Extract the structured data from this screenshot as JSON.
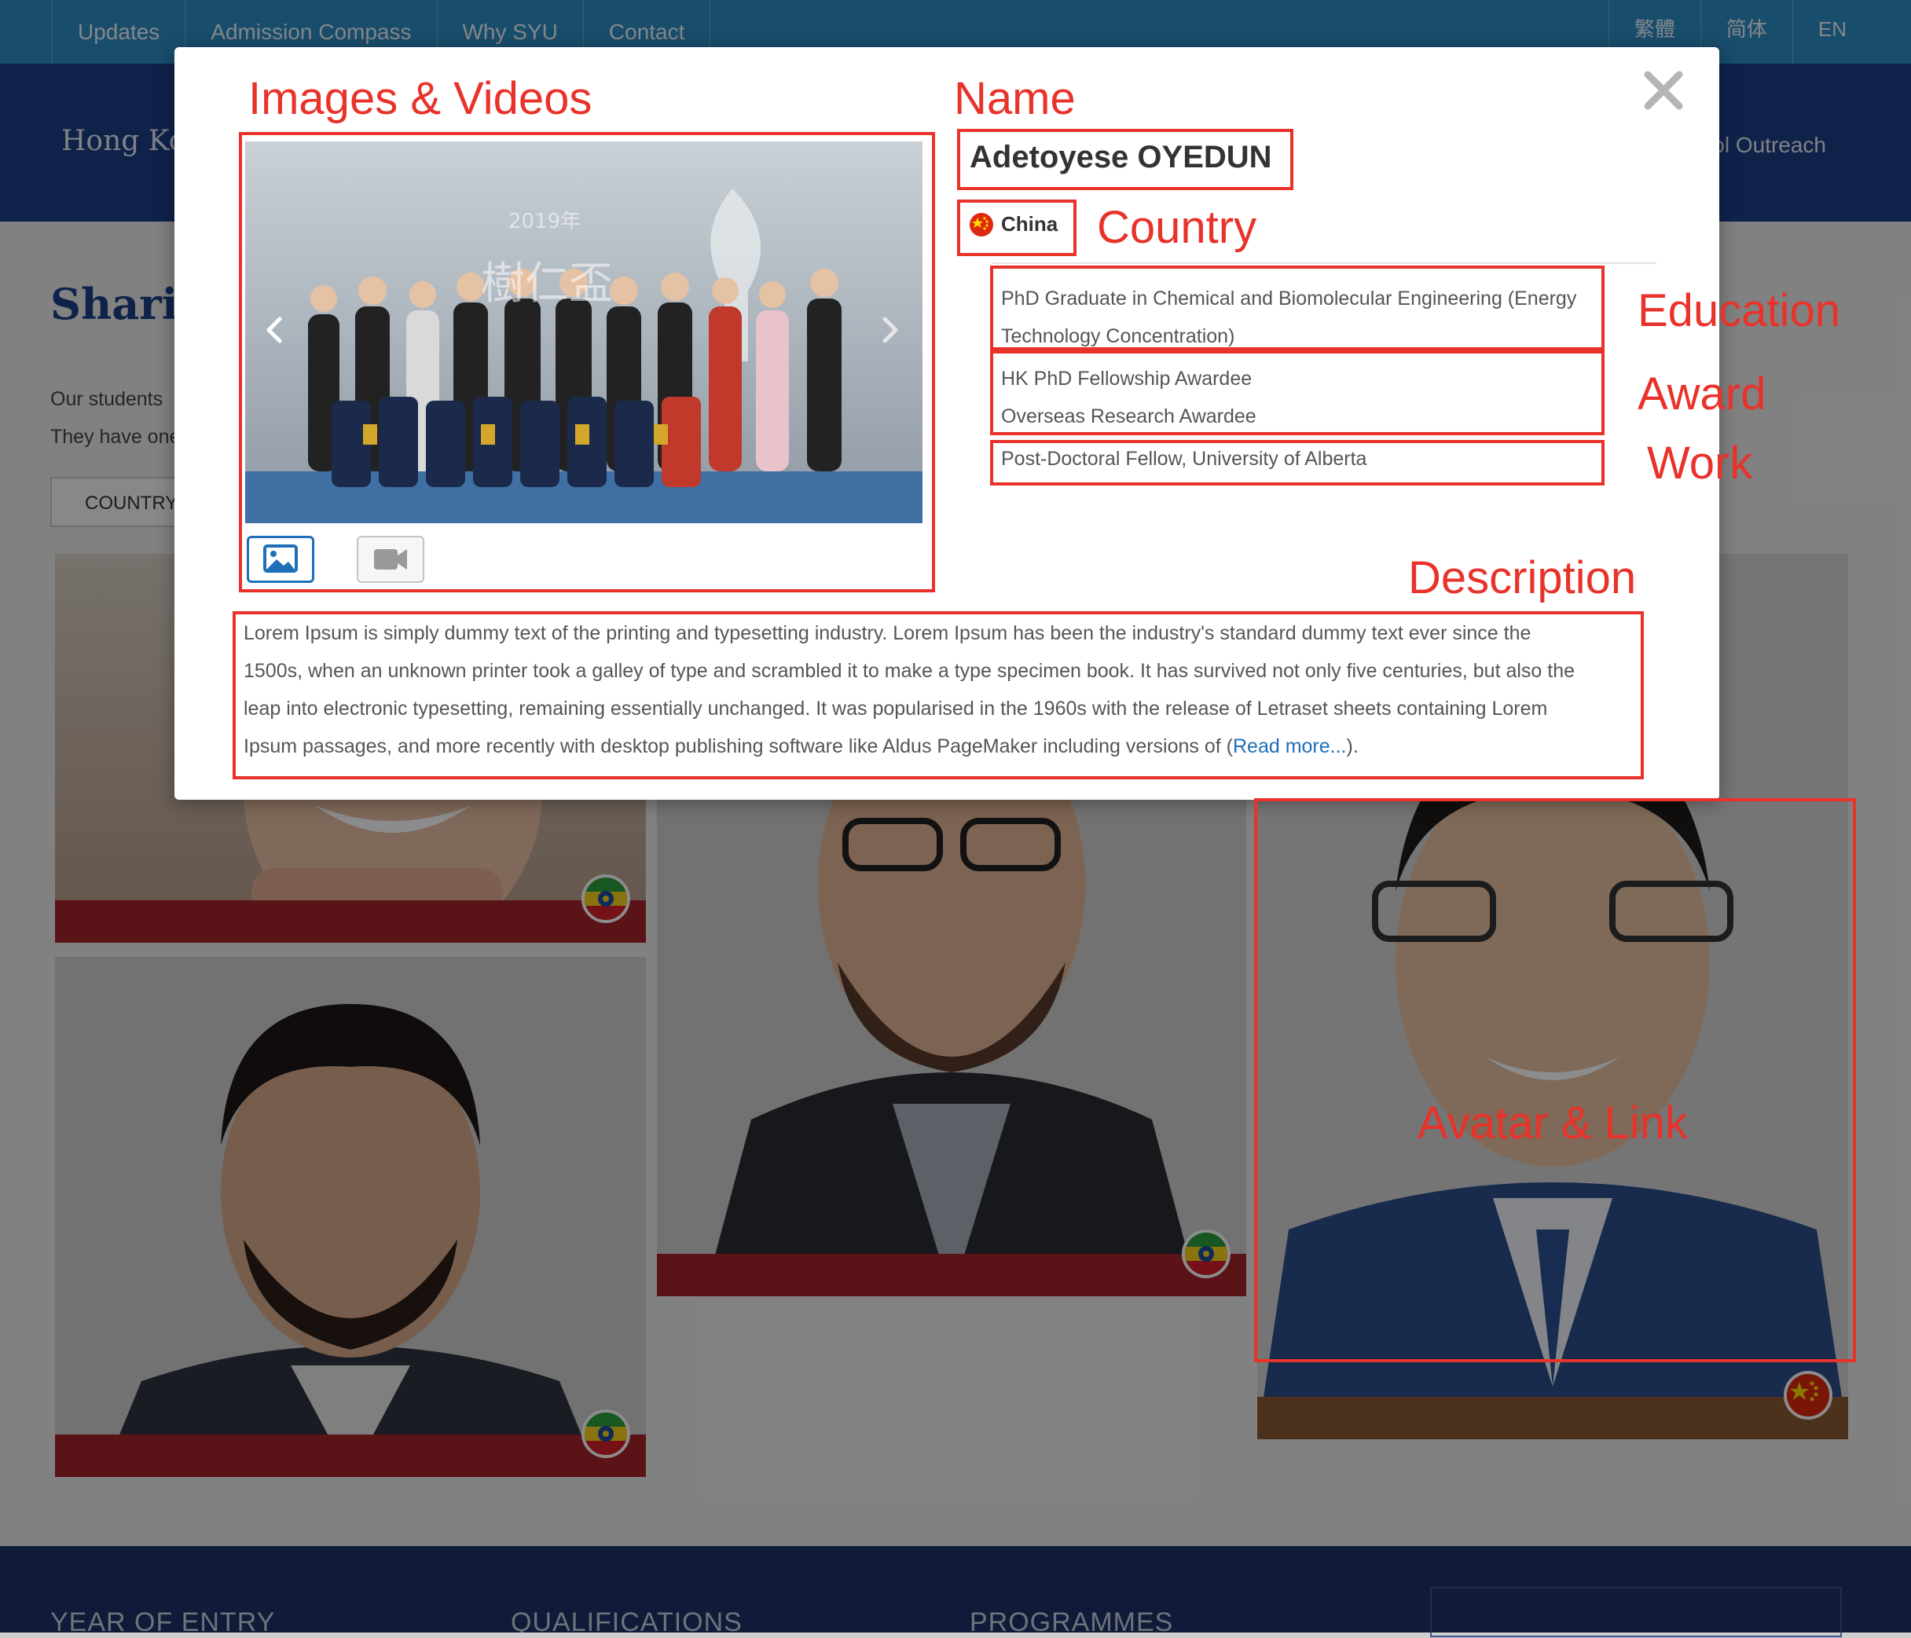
{
  "topbar": {
    "nav": [
      "Updates",
      "Admission Compass",
      "Why SYU",
      "Contact"
    ],
    "languages": [
      "繁體",
      "简体",
      "EN"
    ]
  },
  "header": {
    "brand": "Hong Ko",
    "outreach": "ol Outreach"
  },
  "page": {
    "title": "Shari",
    "intro_line1": "Our students",
    "intro_line2": "They have one",
    "country_filter": "COUNTRY"
  },
  "footer": {
    "year_of_entry": "YEAR OF ENTRY",
    "qualifications": "QUALIFICATIONS",
    "programmes": "PROGRAMMES"
  },
  "modal": {
    "name": "Adetoyese OYEDUN",
    "country": "China",
    "education_line1": "PhD Graduate in Chemical and Biomolecular Engineering (Energy",
    "education_line2": "Technology Concentration)",
    "award_line1": "HK PhD Fellowship Awardee",
    "award_line2": "Overseas Research Awardee",
    "work": "Post-Doctoral Fellow, University of Alberta",
    "description_lines": [
      "Lorem Ipsum is simply dummy text of the printing and typesetting industry. Lorem Ipsum has been the industry's standard dummy text ever since the",
      "1500s, when an unknown printer took a galley of type and scrambled it to make a type specimen book. It has survived not only five centuries, but also the",
      "leap into electronic typesetting, remaining essentially unchanged. It was popularised in the 1960s with the release of Letraset sheets containing Lorem",
      "Ipsum passages, and more recently with desktop publishing software like Aldus PageMaker including versions of ("
    ],
    "read_more": "Read more...",
    "description_end": ").",
    "photo_caption": "樹仁盃",
    "photo_subtitle": "2019年"
  },
  "annotations": {
    "images_videos": "Images & Videos",
    "name": "Name",
    "country": "Country",
    "education": "Education",
    "award": "Award",
    "work": "Work",
    "description": "Description",
    "avatar_link": "Avatar & Link"
  },
  "icons": {
    "close": "close-icon",
    "prev": "chevron-left-icon",
    "next": "chevron-right-icon",
    "image": "image-icon",
    "video": "video-camera-icon",
    "flag_china": "china-flag-icon",
    "flag_ethiopia": "ethiopia-flag-icon"
  },
  "colors": {
    "topbar": "#2e8dc5",
    "header": "#1d3f87",
    "annotation": "#e8322a",
    "link": "#1e6fb8",
    "card_band": "#a5232a"
  }
}
